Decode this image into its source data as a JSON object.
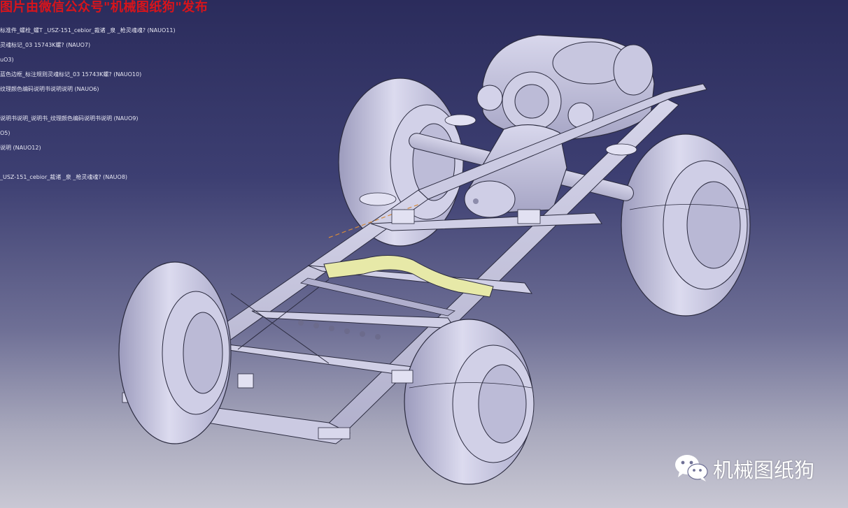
{
  "overlay": {
    "banner_text": "图片由微信公众号\"机械图纸狗\"发布"
  },
  "spec_tree": {
    "nodes": [
      {
        "label": "标准件_螺栓_螺T    _USZ-151_cebior_裁诸   _泉   _枪灵魂魂? (NAUO11)"
      },
      {
        "label": "灵魂标记_03  15743K螺? (NAUO7)"
      },
      {
        "label": "uO3)"
      },
      {
        "label": "蓝色边框_标注规则灵魂标记_03  15743K螺? (NAUO10)"
      },
      {
        "label": "纹理颜色编码说明书说明说明 (NAUO6)"
      },
      {
        "label": "说明书说明_说明书_纹理颜色编码说明书说明 (NAUO9)"
      },
      {
        "label": "O5)"
      },
      {
        "label": "说明 (NAUO12)"
      },
      {
        "label": "_USZ-151_cebior_裁诸   _泉   _枪灵魂魂? (NAUO8)"
      }
    ]
  },
  "brand": {
    "name": "机械图纸狗",
    "icon": "wechat-icon"
  },
  "colors": {
    "background_top": "#2b2c5c",
    "background_bottom": "#c9c8d4",
    "model_body": "#c9c8e4",
    "model_edge": "#2b2b3f",
    "highlight_part": "#e7e9a8",
    "banner": "#d8141b"
  }
}
